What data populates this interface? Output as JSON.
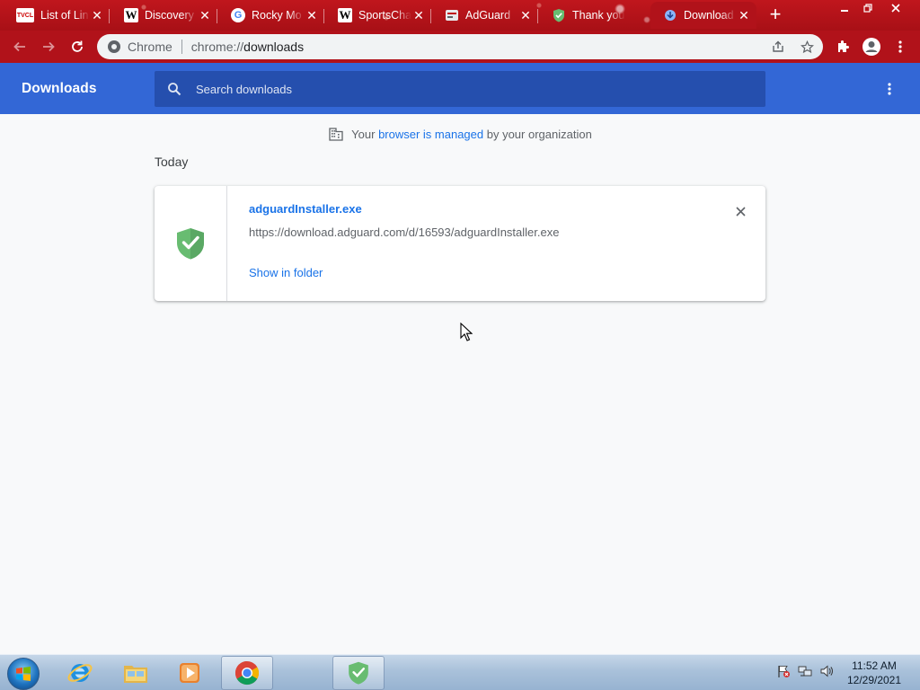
{
  "browser": {
    "tabs": [
      {
        "title": "List of Lin",
        "favicon": "tvcl-favicon",
        "favicon_text": "TVCL"
      },
      {
        "title": "Discovery",
        "favicon": "wikipedia-favicon",
        "favicon_text": "W"
      },
      {
        "title": "Rocky Mo",
        "favicon": "google-favicon",
        "favicon_text": "G"
      },
      {
        "title": "SportsCha",
        "favicon": "wikipedia-favicon",
        "favicon_text": "W"
      },
      {
        "title": "AdGuard",
        "favicon": "adguard-favicon",
        "favicon_text": ""
      },
      {
        "title": "Thank you",
        "favicon": "adguard-shield-favicon",
        "favicon_text": ""
      },
      {
        "title": "Download",
        "favicon": "downloads-favicon",
        "favicon_text": "",
        "active": true
      }
    ],
    "new_tab_label": "+",
    "omnibox": {
      "scheme_label": "Chrome",
      "url_prefix": "chrome://",
      "url_host": "downloads"
    },
    "accent_color": "#b1121a"
  },
  "downloads_page": {
    "title": "Downloads",
    "search_placeholder": "Search downloads",
    "managed_notice": {
      "prefix": "Your ",
      "link_text": "browser is managed",
      "suffix": " by your organization"
    },
    "section_label": "Today",
    "items": [
      {
        "file_name": "adguardInstaller.exe",
        "url": "https://download.adguard.com/d/16593/adguardInstaller.exe",
        "action_label": "Show in folder",
        "icon": "adguard-shield-icon"
      }
    ],
    "header_color": "#3367d6"
  },
  "taskbar": {
    "pinned": [
      "internet-explorer-icon",
      "file-explorer-icon",
      "media-player-icon",
      "chrome-icon",
      "adguard-icon"
    ],
    "clock_time": "11:52 AM",
    "clock_date": "12/29/2021"
  }
}
